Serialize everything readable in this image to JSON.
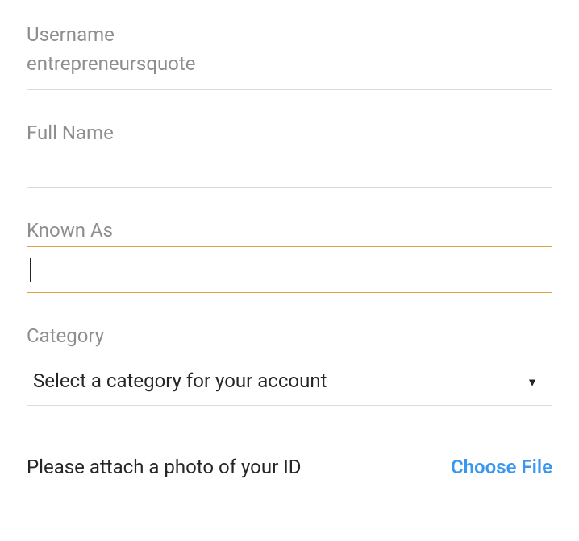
{
  "fields": {
    "username": {
      "label": "Username",
      "value": "entrepreneursquote"
    },
    "fullName": {
      "label": "Full Name",
      "value": ""
    },
    "knownAs": {
      "label": "Known As",
      "value": ""
    },
    "category": {
      "label": "Category",
      "placeholder": "Select a category for your account"
    }
  },
  "attach": {
    "label": "Please attach a photo of your ID",
    "button": "Choose File"
  }
}
